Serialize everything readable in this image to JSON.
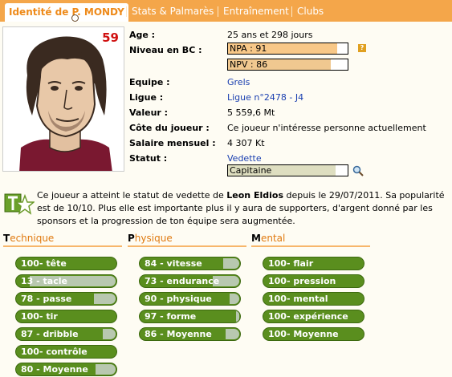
{
  "tabs": [
    "Identité de P. MONDY",
    "Stats & Palmarès",
    "Entraînement",
    "Clubs"
  ],
  "player": {
    "shirt_number": "59",
    "age_label": "Age :",
    "age_value": "25 ans et 298 jours",
    "level_label": "Niveau en BC :",
    "npa_text": "NPA : 91",
    "npa_value": 91,
    "npv_text": "NPV : 86",
    "npv_value": 86,
    "team_label": "Equipe :",
    "team_value": "Grels",
    "league_label": "Ligue :",
    "league_value": "Ligue n°2478 - J4",
    "worth_label": "Valeur :",
    "worth_value": "5 559,6 Mt",
    "rating_label": "Côte du joueur :",
    "rating_value": "Ce joueur n'intéresse personne actuellement",
    "salary_label": "Salaire mensuel :",
    "salary_value": "4 307 Kt",
    "status_label": "Statut :",
    "status_value": "Vedette",
    "captain_value": "Capitaine"
  },
  "message": {
    "part1": "Ce joueur a atteint le statut de vedette de ",
    "name": "Leon Eldios",
    "part2": " depuis le 29/07/2011. Sa popularité est de 10/10. Plus elle est importante plus il y aura de supporters, d'argent donné par les sponsors et la progression de ton équipe sera augmentée."
  },
  "sections": [
    {
      "first": "T",
      "rest": "echnique",
      "skills": [
        {
          "text": "100- tête",
          "value": 100
        },
        {
          "text": "13 - tacle",
          "value": 13
        },
        {
          "text": "78 - passe",
          "value": 78
        },
        {
          "text": "100- tir",
          "value": 100
        },
        {
          "text": "87 - dribble",
          "value": 87
        },
        {
          "text": "100- contrôle",
          "value": 100
        },
        {
          "text": "80 - Moyenne",
          "value": 80
        }
      ]
    },
    {
      "first": "P",
      "rest": "hysique",
      "skills": [
        {
          "text": "84 - vitesse",
          "value": 84
        },
        {
          "text": "73 - endurance",
          "value": 73
        },
        {
          "text": "90 - physique",
          "value": 90
        },
        {
          "text": "97 - forme",
          "value": 97
        },
        {
          "text": "86 - Moyenne",
          "value": 86
        }
      ]
    },
    {
      "first": "M",
      "rest": "ental",
      "skills": [
        {
          "text": "100- flair",
          "value": 100
        },
        {
          "text": "100- pression",
          "value": 100
        },
        {
          "text": "100- mental",
          "value": 100
        },
        {
          "text": "100- expérience",
          "value": 100
        },
        {
          "text": "100- Moyenne",
          "value": 100
        }
      ]
    }
  ],
  "icons": {
    "help": "question-icon",
    "search": "search-icon",
    "star": "star-badge-icon",
    "ball": "ball-icon"
  },
  "colors": {
    "tab_bar": "#f4a64a",
    "active_tab_text": "#ee8a1a",
    "skill_green": "#5a8e1e",
    "npa_fill": "#f8c888",
    "npv_fill": "#f0c890",
    "captain_fill": "#dedec0"
  }
}
